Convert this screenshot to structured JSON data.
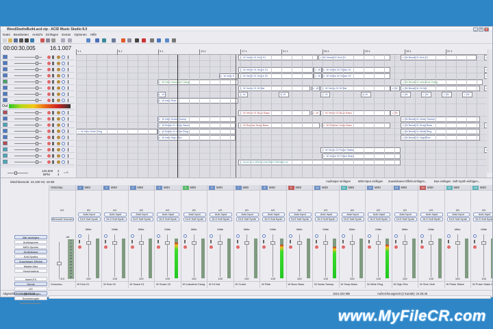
{
  "window": {
    "title": "WeedStudioBuild.acd-zip - ACID Music Studio 8.0",
    "min": "_",
    "max": "□",
    "close": "x"
  },
  "menu": [
    "Datei",
    "Bearbeiten",
    "Ansicht",
    "Einfügen",
    "Extras",
    "Optionen",
    "Hilfe"
  ],
  "toolbar_icons": [
    "new-icon",
    "open-icon",
    "save-icon",
    "print-icon",
    "properties-icon",
    "render-icon",
    "cut-icon",
    "copy-icon",
    "paste-icon",
    "undo-icon",
    "redo-icon",
    "zoom-tool-icon",
    "snap-icon",
    "envelope-icon",
    "grid-icon",
    "draw-tool-icon",
    "select-tool-icon",
    "paint-tool-icon",
    "erase-tool-icon",
    "pitch-icon",
    "split-icon",
    "loop-icon",
    "metronome-icon"
  ],
  "timecode": "00:00:30,005",
  "position": "16.1.007",
  "ruler": [
    "1.1",
    "5.1",
    "9.1",
    "13.1",
    "17.1",
    "21.1",
    "25.1",
    "29.1",
    "33.1",
    "37.1",
    "41.1"
  ],
  "out_label": "Out",
  "tempo": {
    "bpm": "120,000",
    "bpm_label": "BPM",
    "sig_top": "4",
    "sig_bottom": "4",
    "key": "= A"
  },
  "tracks": [
    {
      "color": "#4f78c0",
      "clips": [
        {
          "s": 16.8,
          "e": 24.5,
          "label": "W Verse 01 Kick 01"
        },
        {
          "s": 24.6,
          "e": 31.6,
          "label": "W Verse 02 Kick 01"
        },
        {
          "s": 32.6,
          "e": 40,
          "label": "W Break 01 Kick 01"
        },
        {
          "s": 40.7,
          "e": 41.3,
          "label": "W"
        }
      ]
    },
    {
      "color": "#4f78c0",
      "clips": []
    },
    {
      "color": "#4f78c0",
      "clips": [
        {
          "s": 16.8,
          "e": 24.1,
          "label": "W Verse 01 Snare 01"
        },
        {
          "s": 24.1,
          "e": 24.9,
          "label": "W"
        },
        {
          "s": 24.9,
          "e": 31.6,
          "label": "W Verse 02 Snare 01"
        },
        {
          "s": 40.7,
          "e": 41.3,
          "label": "W"
        }
      ]
    },
    {
      "color": "#4f78c0",
      "clips": [
        {
          "s": 14.9,
          "e": 16.8,
          "label": "W Intro S"
        },
        {
          "s": 16.8,
          "e": 24.1,
          "label": "W Verse 01 Snare 02"
        },
        {
          "s": 24.1,
          "e": 24.9,
          "label": "W"
        },
        {
          "s": 24.9,
          "e": 31.6,
          "label": "W Verse 02 Snare 02"
        },
        {
          "s": 40.7,
          "e": 41.3,
          "label": "W"
        }
      ]
    },
    {
      "color": "#49a85a",
      "clips": [
        {
          "s": 8.9,
          "e": 16.8,
          "label": "W Intro Industrial Clang",
          "c": "#3f9a52"
        },
        {
          "s": 32.6,
          "e": 40.6,
          "label": "W Break 01 Industrial Clang",
          "c": "#3f9a52"
        }
      ]
    },
    {
      "color": "#4f78c0",
      "clips": [
        {
          "s": 16.8,
          "e": 23.8,
          "label": "W Verse 01 Hi Hat"
        },
        {
          "s": 23.9,
          "e": 24.7,
          "label": "W"
        },
        {
          "s": 24.8,
          "e": 31.6,
          "label": "W Verse 02 Hi Hat"
        },
        {
          "s": 31.6,
          "e": 32.5,
          "label": "W"
        },
        {
          "s": 32.6,
          "e": 40.3,
          "label": "W Break 01 Hi Hat"
        },
        {
          "s": 40.7,
          "e": 41.3,
          "label": "W"
        }
      ]
    },
    {
      "color": "#4f78c0",
      "clips": [
        {
          "s": 8.9,
          "e": 9.7,
          "label": "W"
        },
        {
          "s": 16.8,
          "e": 17.7,
          "label": "W"
        },
        {
          "s": 20.7,
          "e": 21.7,
          "label": "W"
        },
        {
          "s": 24.8,
          "e": 25.7,
          "label": "W"
        },
        {
          "s": 28.7,
          "e": 29.7,
          "label": "W"
        },
        {
          "s": 32.6,
          "e": 33.6,
          "label": "W"
        },
        {
          "s": 34.6,
          "e": 35.6,
          "label": "W"
        },
        {
          "s": 36.6,
          "e": 37.6,
          "label": "W"
        },
        {
          "s": 38.6,
          "e": 39.6,
          "label": "W"
        }
      ]
    },
    {
      "color": "#4f78c0",
      "clips": [
        {
          "s": 8.9,
          "e": 16.8,
          "label": "W Intro Ride"
        }
      ]
    },
    {
      "color": "#b84a4a",
      "clips": [
        {
          "s": 16.8,
          "e": 23.8,
          "label": "W Verse 01 Buzz Bass",
          "c": "#b03c3c"
        },
        {
          "s": 23.9,
          "e": 24.8,
          "label": "W",
          "c": "#b03c3c"
        },
        {
          "s": 24.8,
          "e": 31.6,
          "label": "W Verse 02 Buzz Bass",
          "c": "#b03c3c"
        },
        {
          "s": 31.6,
          "e": 32.5,
          "label": "W",
          "c": "#b03c3c"
        }
      ]
    },
    {
      "color": "#4f78c0",
      "clips": [
        {
          "s": 8.9,
          "e": 16.5,
          "label": "W Intro Noise Sweep"
        },
        {
          "s": 32.6,
          "e": 40.3,
          "label": "W Break 01 Noise Sweep"
        }
      ]
    },
    {
      "color": "#4aa9b0",
      "clips": [
        {
          "s": 8.9,
          "e": 16.5,
          "label": "W Break 01 Snap Bass"
        },
        {
          "s": 16.8,
          "e": 24.7,
          "label": "W Reprise Snap Bass",
          "c": "#b03c3c"
        },
        {
          "s": 24.9,
          "e": 31.6,
          "label": "W Reprise Snap Bass",
          "c": "#b03c3c"
        },
        {
          "s": 32.6,
          "e": 40.3,
          "label": "W Break 01 Snap Bass"
        },
        {
          "s": 40.7,
          "e": 41.3,
          "label": "W"
        }
      ]
    },
    {
      "color": "#4f78c0",
      "clips": [
        {
          "s": 1,
          "e": 8.9,
          "label": "W Intro Wide Ring"
        },
        {
          "s": 8.9,
          "e": 16.5,
          "label": "W Break 01 Wide Ring"
        },
        {
          "s": 32.6,
          "e": 40.3,
          "label": "W Break 01 Wide Ring"
        }
      ]
    },
    {
      "color": "#4f78c0",
      "clips": [
        {
          "s": 8.9,
          "e": 16.5,
          "label": "W Intro High Rez"
        },
        {
          "s": 32.6,
          "e": 40.3,
          "label": "W Break 01 High Rez"
        }
      ]
    },
    {
      "color": "#b84a4a",
      "clips": []
    },
    {
      "color": "#4aa9b0",
      "clips": [
        {
          "s": 24.8,
          "e": 32.6,
          "label": "W Verse 02 Pulse Stabs"
        },
        {
          "s": 40.7,
          "e": 41.3,
          "label": "W"
        }
      ]
    },
    {
      "color": "#4aa9b0",
      "clips": [
        {
          "s": 24.9,
          "e": 32.6,
          "label": "W Verse 02 Pulse Stabs"
        }
      ]
    },
    {
      "color": "#4aa9b0",
      "clips": [
        {
          "s": 16.8,
          "e": 32.6,
          "label": "W ACID 6 PRO CONTENT PROMO 01",
          "c": "#2f8d98"
        }
      ]
    }
  ],
  "mixer": {
    "title": "Mischkonsole: 44.100 Hz; 16 Bit",
    "toolbar": [
      "Audiospur einfügen",
      "MIDI-Spur einfügen",
      "Zuweisbaren Effekt einfügen...",
      "Bus einfügen",
      "Soft-Synth einfügen..."
    ],
    "left_buttons": [
      "Alle anzeigen",
      "Audiospuren",
      "MIDI-Spuren",
      "Audiobusse",
      "Soft-Synths",
      "Zuweisbare Effekte",
      "Master-Bus",
      "Vorschaubus",
      "Insert-FX",
      "Sends",
      "I/O",
      "Regler anzeigen",
      "Schieberegler"
    ],
    "preview": {
      "name": "Vorschau",
      "io": "I/O",
      "device": "Microsoft Soundma...",
      "peak": "-Inf.",
      "db": "-6,0",
      "scale": [
        "3",
        "9",
        "15",
        "21",
        "27",
        "33",
        "39",
        "45",
        "51",
        "57",
        "63",
        "70",
        "80"
      ]
    },
    "type_label": "MIDI",
    "io_label": "I/O",
    "auto_input": "Auto Input",
    "synth": "DLS Soft Synth",
    "pan": "Mitte",
    "volume": "100",
    "channels": [
      {
        "n": "1",
        "name": "W Kick 01",
        "c": "#6d8fc4",
        "level": 0
      },
      {
        "n": "2",
        "name": "W Kick 02",
        "c": "#6d8fc4",
        "level": 0
      },
      {
        "n": "3",
        "name": "W Snare 01",
        "c": "#6d8fc4",
        "level": 0
      },
      {
        "n": "4",
        "name": "W Snare 02",
        "c": "#6d8fc4",
        "level": 0.9
      },
      {
        "n": "5",
        "name": "W Industrial Clang",
        "c": "#58b868",
        "level": 0
      },
      {
        "n": "6",
        "name": "W Hi Hat",
        "c": "#6d8fc4",
        "level": 0
      },
      {
        "n": "7",
        "name": "W Crash",
        "c": "#6d8fc4",
        "level": 0
      },
      {
        "n": "8",
        "name": "W Ride",
        "c": "#6d8fc4",
        "level": 0.85
      },
      {
        "n": "9",
        "name": "W Buzz Bass",
        "c": "#c25a5a",
        "level": 0
      },
      {
        "n": "10",
        "name": "W Noise Sweep",
        "c": "#6d8fc4",
        "level": 0.8
      },
      {
        "n": "11",
        "name": "W Snap Bass",
        "c": "#5bb4b8",
        "level": 0
      },
      {
        "n": "12",
        "name": "W Wide Ring",
        "c": "#6d8fc4",
        "level": 0.85
      },
      {
        "n": "13",
        "name": "W High Rez",
        "c": "#6d8fc4",
        "level": 0
      },
      {
        "n": "14",
        "name": "W Sine Verb",
        "c": "#c25a5a",
        "level": 0
      },
      {
        "n": "15",
        "name": "W Pulse Stabs",
        "c": "#5bb4b8",
        "level": 0
      },
      {
        "n": "16",
        "name": "W Pulse Stabs D",
        "c": "#5bb4b8",
        "level": 0
      }
    ]
  },
  "status": {
    "left": "Abgeschlossen: 00:00:00",
    "disk": "1521.023 MB",
    "rec": "Aufzeichnungszeit (2 Kanäle): 24:25:45"
  },
  "watermark": "www.MyFileCR.com"
}
